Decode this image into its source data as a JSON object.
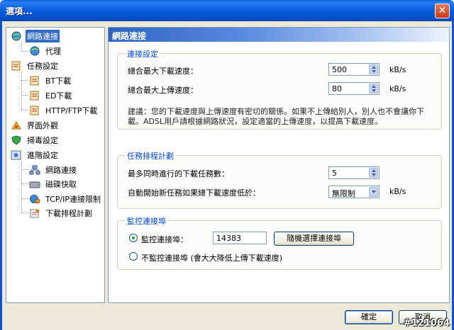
{
  "window": {
    "title": "選項..."
  },
  "tree": {
    "items": [
      {
        "label": "網路連接",
        "icon": "network-globe-icon",
        "selected": true
      },
      {
        "label": "代理",
        "icon": "proxy-globe-icon"
      },
      {
        "label": "任務設定",
        "icon": "task-clipboard-icon"
      },
      {
        "label": "BT下載",
        "icon": "bt-clipboard-icon"
      },
      {
        "label": "ED下載",
        "icon": "ed-clipboard-icon"
      },
      {
        "label": "HTTP/FTP下載",
        "icon": "http-clipboard-icon"
      },
      {
        "label": "界面外觀",
        "icon": "appearance-icon"
      },
      {
        "label": "掃毒設定",
        "icon": "antivirus-shield-icon"
      },
      {
        "label": "進階設定",
        "icon": "advanced-settings-icon"
      },
      {
        "label": "網路連接",
        "icon": "network-connection-icon"
      },
      {
        "label": "磁碟快取",
        "icon": "disk-cache-icon"
      },
      {
        "label": "TCP/IP連接限制",
        "icon": "tcpip-icon"
      },
      {
        "label": "下載排程計劃",
        "icon": "schedule-icon"
      }
    ]
  },
  "content": {
    "header": "網路連接",
    "connection": {
      "title": "連接設定",
      "max_download_label": "總合最大下載速度：",
      "max_download_value": "500",
      "max_upload_label": "總合最大上傳速度：",
      "max_upload_value": "80",
      "unit": "kB/s",
      "note": "建議：您的下載速度與上傳速度有密切的關係。如果不上傳給別人，別人也不會讓你下載。ADSL用戶請根據網路狀況，設定適當的上傳速度，以提高下載速度。"
    },
    "schedule": {
      "title": "任務排程計劃",
      "max_tasks_label": "最多同時進行的下載任務數：",
      "max_tasks_value": "5",
      "auto_start_label": "自動開始新任務如果總下載速度低於：",
      "auto_start_value": "無限制",
      "unit": "kB/s"
    },
    "monitor": {
      "title": "監控連接埠",
      "monitor_port_label": "監控連接埠：",
      "port_value": "14383",
      "random_button": "隨機選擇連接埠",
      "no_monitor_label": "不監控連接埠 (會大大降低上傳下載速度)",
      "selected": "monitor"
    }
  },
  "footer": {
    "ok_label": "確定",
    "cancel_label": "取消"
  },
  "watermark": "#121064",
  "colors": {
    "titlebar": "#0b5ee0",
    "selection": "#316ac5",
    "group_title": "#0046d5"
  }
}
